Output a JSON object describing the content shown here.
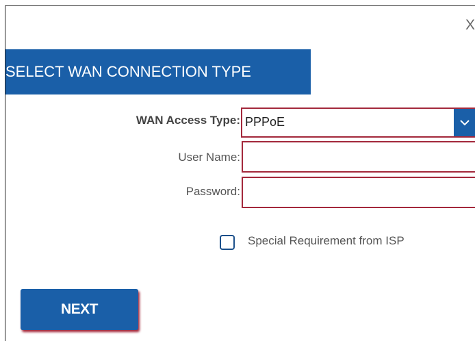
{
  "dialog": {
    "close_label": "X",
    "title": "SELECT WAN CONNECTION TYPE"
  },
  "form": {
    "wan_access_type_label": "WAN Access Type:",
    "wan_access_type_value": "PPPoE",
    "user_name_label": "User Name:",
    "user_name_value": "",
    "password_label": "Password:",
    "password_value": "",
    "special_requirement_label": "Special Requirement from ISP",
    "special_requirement_checked": false
  },
  "actions": {
    "next_label": "NEXT"
  },
  "colors": {
    "accent_blue": "#1a5fa8",
    "field_border": "#a3283b"
  }
}
